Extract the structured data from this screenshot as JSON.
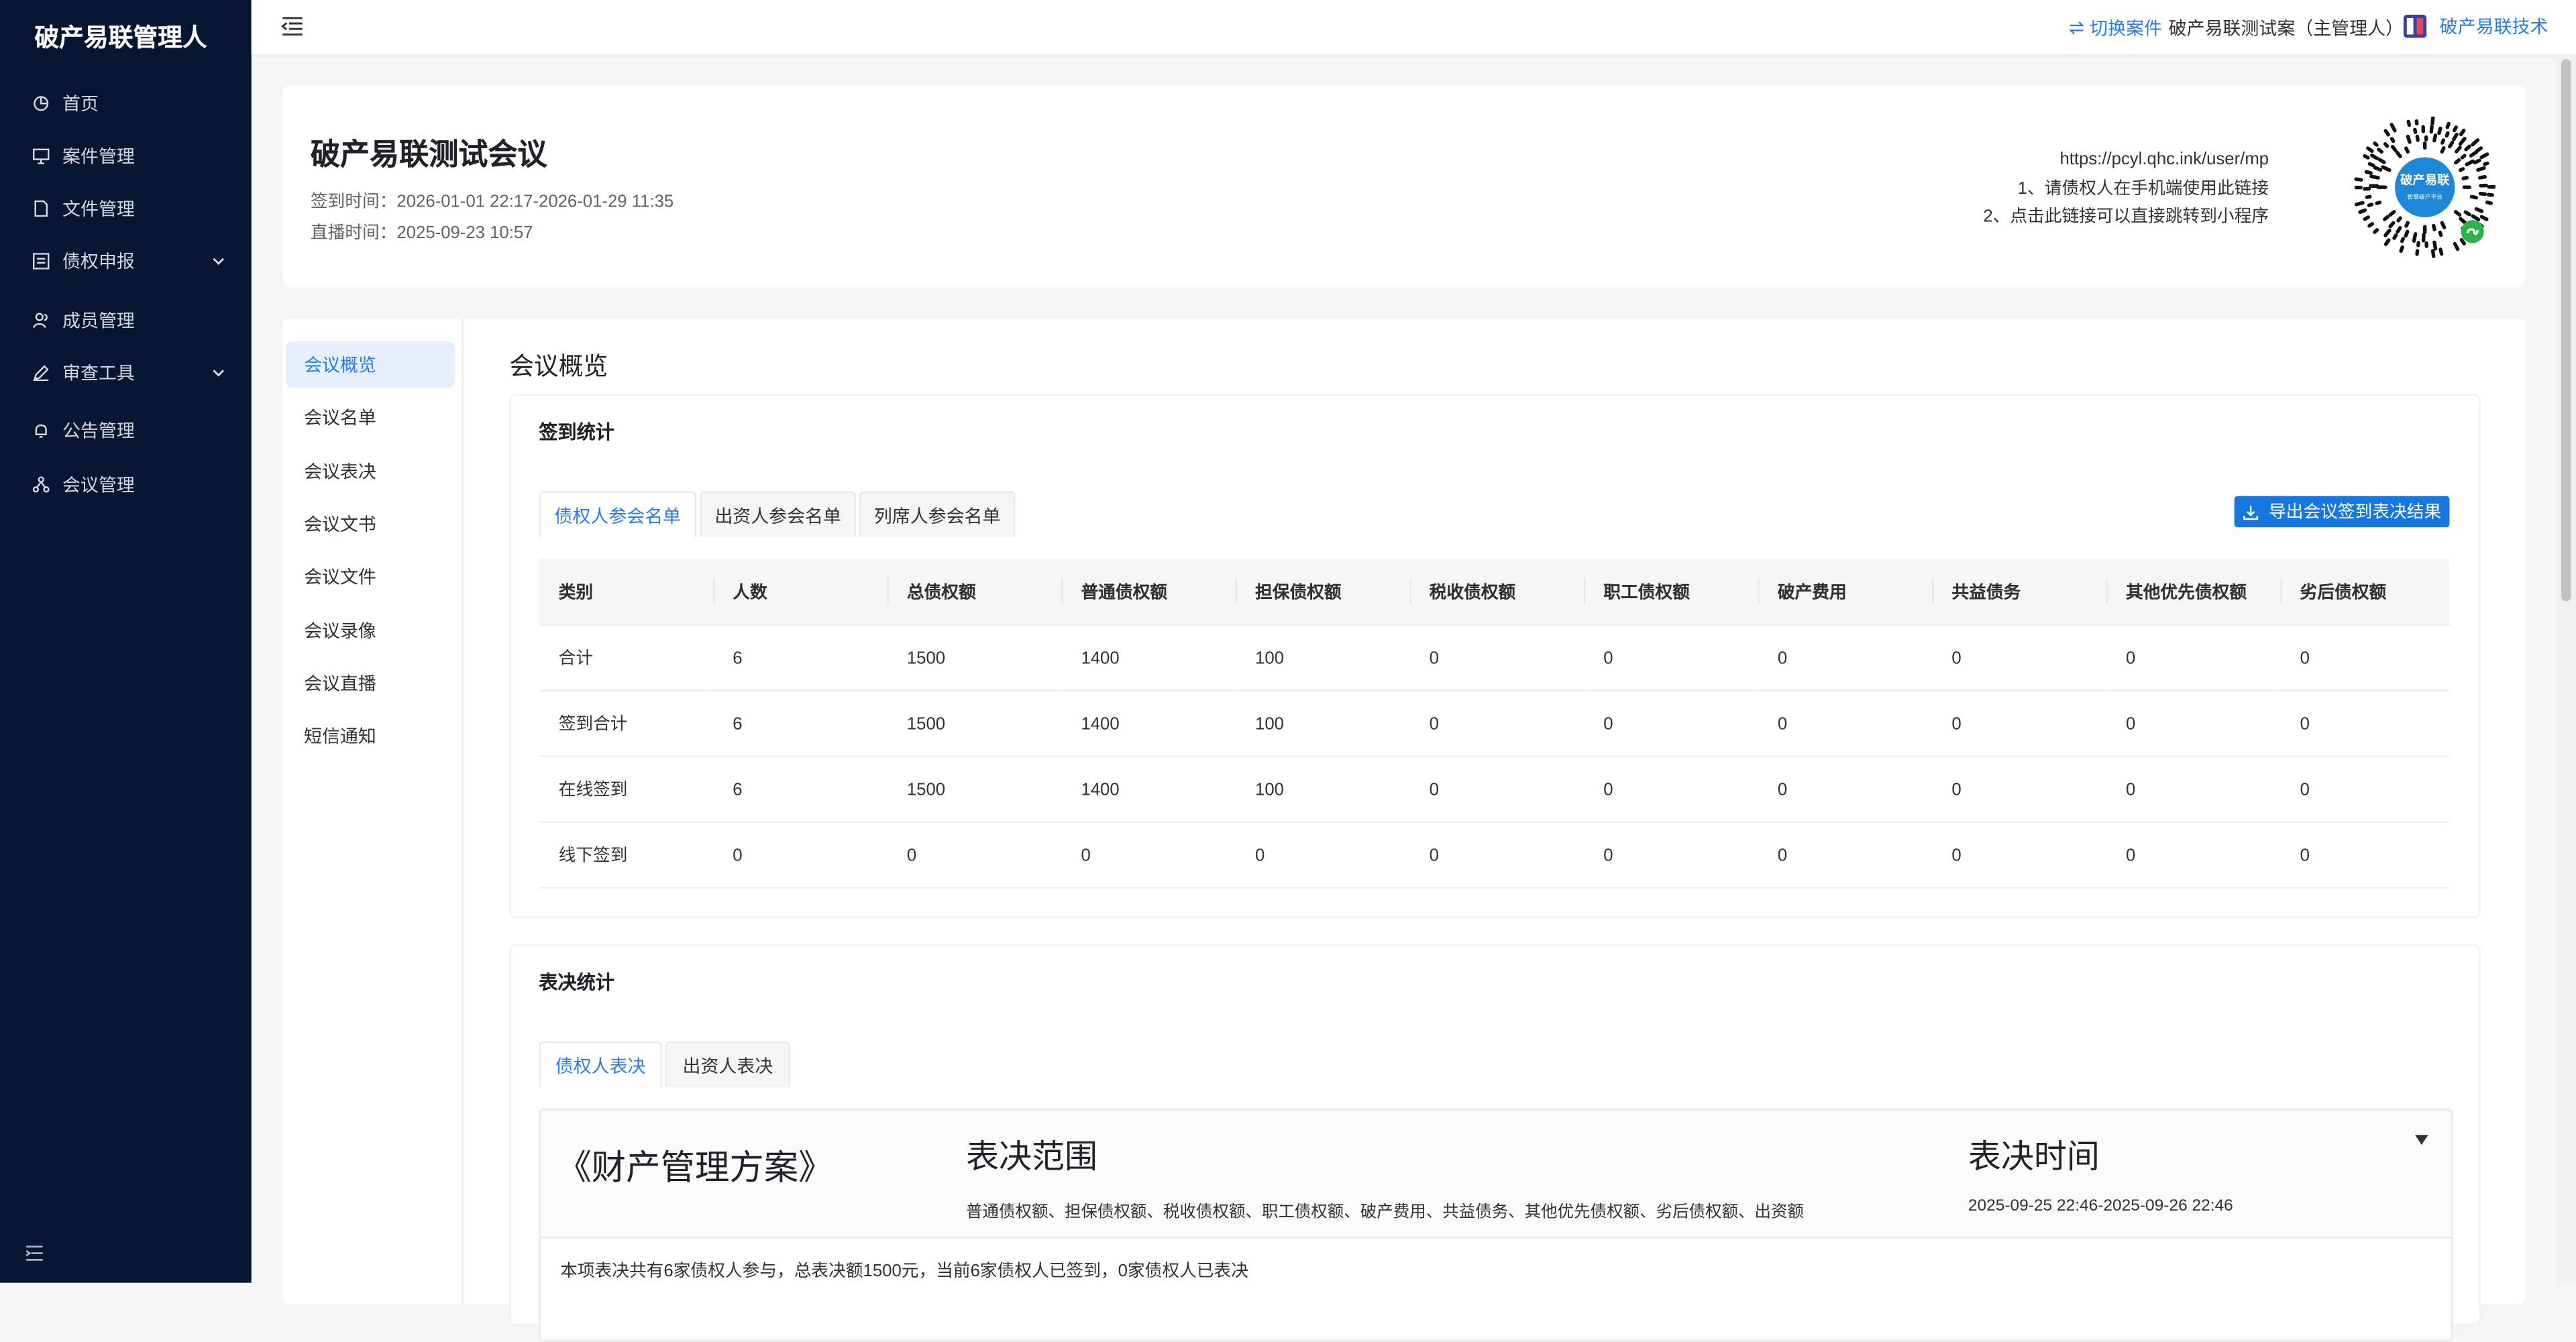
{
  "sidebar": {
    "brand": "破产易联管理人",
    "items": [
      {
        "label": "首页",
        "icon": "dashboard-icon"
      },
      {
        "label": "案件管理",
        "icon": "monitor-icon"
      },
      {
        "label": "文件管理",
        "icon": "file-icon"
      },
      {
        "label": "债权申报",
        "icon": "form-icon",
        "expandable": true
      },
      {
        "label": "成员管理",
        "icon": "users-icon"
      },
      {
        "label": "审查工具",
        "icon": "pen-icon",
        "expandable": true
      },
      {
        "label": "公告管理",
        "icon": "bell-icon"
      },
      {
        "label": "会议管理",
        "icon": "network-icon"
      }
    ]
  },
  "topbar": {
    "switch_label": "切换案件",
    "case_name": "破产易联测试案（主管理人）",
    "org_name": "破产易联技术"
  },
  "meeting": {
    "title": "破产易联测试会议",
    "sign_time": "签到时间：2026-01-01 22:17-2026-01-29 11:35",
    "live_time": "直播时间：2025-09-23 10:57",
    "url": "https://pcyl.qhc.ink/user/mp",
    "tip1": "1、请债权人在手机端使用此链接",
    "tip2": "2、点击此链接可以直接跳转到小程序",
    "qr_label_1": "破产易联",
    "qr_label_2": "智慧破产平台"
  },
  "subnav": [
    "会议概览",
    "会议名单",
    "会议表决",
    "会议文书",
    "会议文件",
    "会议录像",
    "会议直播",
    "短信通知"
  ],
  "overview": {
    "title": "会议概览",
    "signin": {
      "title": "签到统计",
      "tabs": [
        "债权人参会名单",
        "出资人参会名单",
        "列席人参会名单"
      ],
      "export_label": "导出会议签到表决结果",
      "columns": [
        "类别",
        "人数",
        "总债权额",
        "普通债权额",
        "担保债权额",
        "税收债权额",
        "职工债权额",
        "破产费用",
        "共益债务",
        "其他优先债权额",
        "劣后债权额"
      ],
      "rows": [
        [
          "合计",
          "6",
          "1500",
          "1400",
          "100",
          "0",
          "0",
          "0",
          "0",
          "0",
          "0"
        ],
        [
          "签到合计",
          "6",
          "1500",
          "1400",
          "100",
          "0",
          "0",
          "0",
          "0",
          "0",
          "0"
        ],
        [
          "在线签到",
          "6",
          "1500",
          "1400",
          "100",
          "0",
          "0",
          "0",
          "0",
          "0",
          "0"
        ],
        [
          "线下签到",
          "0",
          "0",
          "0",
          "0",
          "0",
          "0",
          "0",
          "0",
          "0",
          "0"
        ]
      ]
    },
    "vote": {
      "title": "表决统计",
      "tabs": [
        "债权人表决",
        "出资人表决"
      ],
      "doc_title": "《财产管理方案》",
      "scope_heading": "表决范围",
      "scope_value": "普通债权额、担保债权额、税收债权额、职工债权额、破产费用、共益债务、其他优先债权额、劣后债权额、出资额",
      "time_heading": "表决时间",
      "time_value": "2025-09-25 22:46-2025-09-26 22:46",
      "summary": "本项表决共有6家债权人参与，总表决额1500元，当前6家债权人已签到，0家债权人已表决"
    }
  },
  "colors": {
    "sidebar_bg": "#061530",
    "accent": "#2d7be0",
    "button": "#1677e0"
  }
}
